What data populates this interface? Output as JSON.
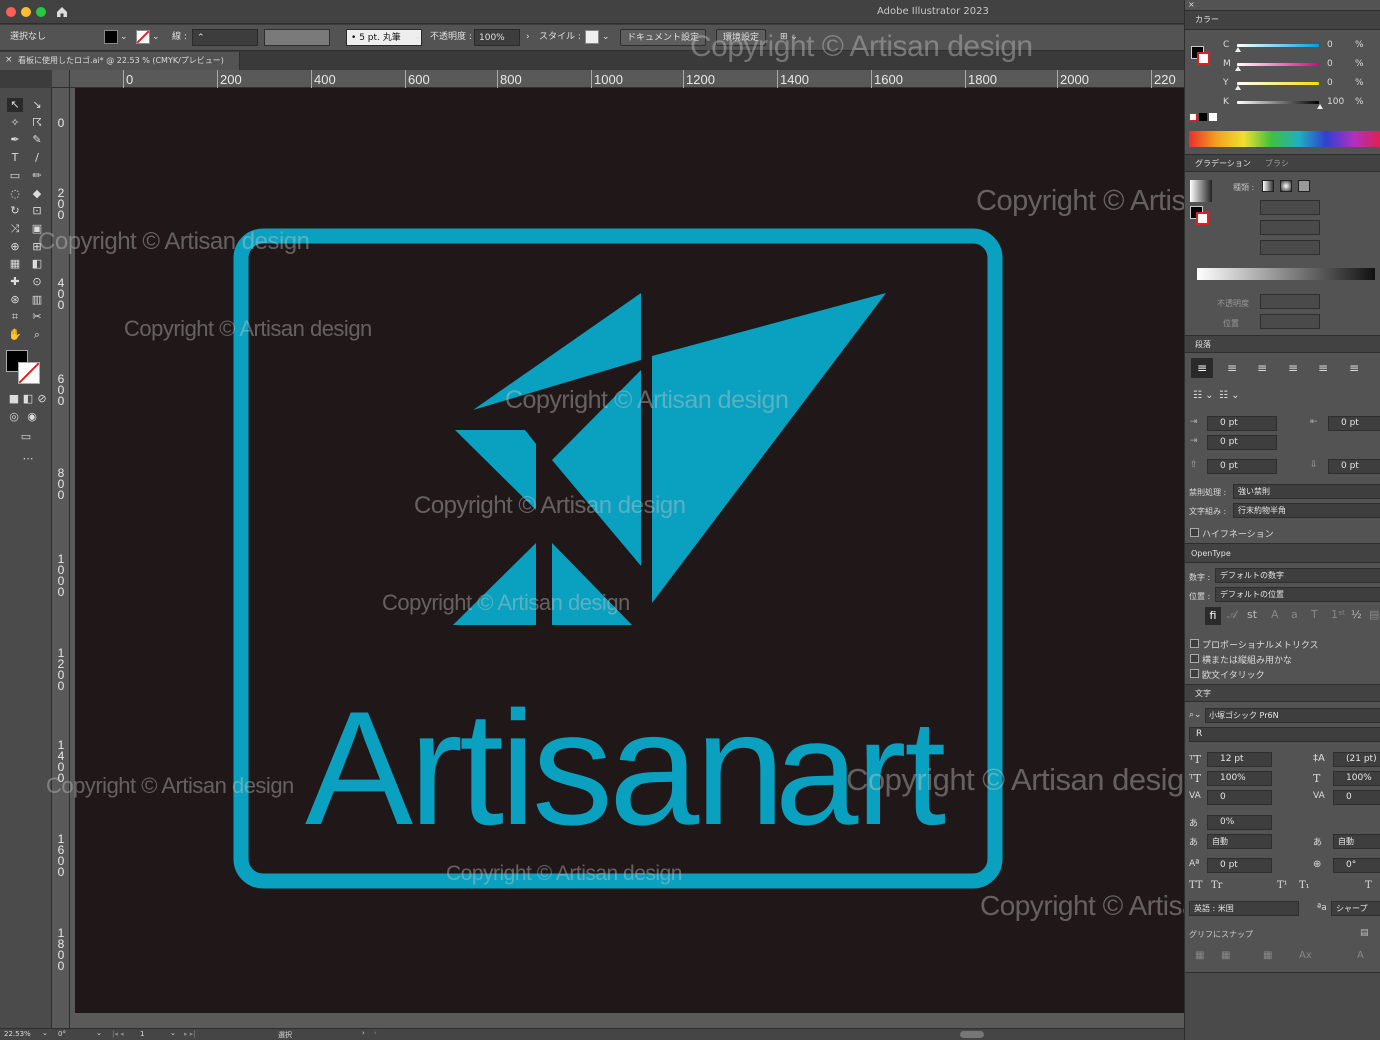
{
  "app": {
    "title": "Adobe Illustrator 2023"
  },
  "control_bar": {
    "selection": "選択なし",
    "stroke_label": "線 :",
    "brush": "5 pt. 丸筆",
    "opacity_label": "不透明度 :",
    "opacity_value": "100%",
    "style_label": "スタイル :",
    "doc_setup": "ドキュメント設定",
    "prefs": "環境設定"
  },
  "document": {
    "tab_title": "看板に使用したロゴ.ai* @ 22.53 % (CMYK/プレビュー)",
    "close": "×"
  },
  "ruler": {
    "h_ticks": [
      "0",
      "200",
      "400",
      "600",
      "800",
      "1000",
      "1200",
      "1400",
      "1600",
      "1800",
      "2000",
      "220"
    ],
    "v_ticks": [
      "0",
      "200",
      "400",
      "600",
      "800",
      "1000",
      "1200",
      "1400",
      "1600",
      "1800"
    ]
  },
  "artwork": {
    "logo_word1": "Artisan",
    "logo_word2": "art",
    "logo_color": "#0aa0c0",
    "background_color": "#201818"
  },
  "watermark": {
    "text": "Copyright © Artisan design"
  },
  "color_panel": {
    "tab": "カラー",
    "channels": [
      {
        "name": "C",
        "value": "0",
        "unit": "%"
      },
      {
        "name": "M",
        "value": "0",
        "unit": "%"
      },
      {
        "name": "Y",
        "value": "0",
        "unit": "%"
      },
      {
        "name": "K",
        "value": "100",
        "unit": "%"
      }
    ]
  },
  "gradient_panel": {
    "tab": "グラデーション",
    "tab2": "ブラシ",
    "type_label": "種類 :",
    "opacity_label": "不透明度",
    "position_label": "位置"
  },
  "paragraph_panel": {
    "tab": "段落",
    "indent_left": "0 pt",
    "indent_right": "0 pt",
    "first_line": "0 pt",
    "space_before": "0 pt",
    "space_after": "0 pt",
    "kinsoku_label": "禁則処理 :",
    "kinsoku_value": "強い禁則",
    "mojikumi_label": "文字組み :",
    "mojikumi_value": "行末約物半角",
    "hyphenation": "ハイフネーション"
  },
  "opentype_panel": {
    "tab": "OpenType",
    "figure_label": "数字 :",
    "figure_value": "デフォルトの数字",
    "position_label": "位置 :",
    "position_value": "デフォルトの位置",
    "opt1": "プロポーショナルメトリクス",
    "opt2": "横または縦組み用かな",
    "opt3": "欧文イタリック"
  },
  "character_panel": {
    "tab": "文字",
    "font": "小塚ゴシック Pr6N",
    "style": "R",
    "size": "12 pt",
    "leading": "(21 pt)",
    "vscale": "100%",
    "hscale": "100%",
    "kerning": "0",
    "tracking": "0",
    "tsume": "0%",
    "aki_left": "自動",
    "aki_right": "自動",
    "baseline": "0 pt",
    "rotation": "0°",
    "language": "英語 : 米国",
    "antialias": "シャープ",
    "snap": "グリフにスナップ"
  },
  "status": {
    "zoom": "22.53%",
    "angle": "0°",
    "artboard": "1",
    "tool": "選択"
  }
}
